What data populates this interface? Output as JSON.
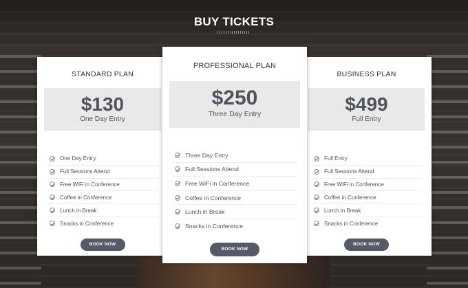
{
  "header": {
    "title": "BUY TICKETS"
  },
  "plans": [
    {
      "name": "STANDARD PLAN",
      "price": "$130",
      "entry": "One Day Entry",
      "features": [
        "One Day Entry",
        "Full Sessions Attend",
        "Free WiFi in Conference",
        "Coffee in Conference",
        "Lunch in Break",
        "Snacks in Conference"
      ],
      "button": "BOOK NOW"
    },
    {
      "name": "PROFESSIONAL PLAN",
      "price": "$250",
      "entry": "Three Day Entry",
      "features": [
        "Three Day Entry",
        "Full Sessions Attend",
        "Free WiFi in Conference",
        "Coffee in Conference",
        "Lunch in Break",
        "Snacks in Conference"
      ],
      "button": "BOOK NOW"
    },
    {
      "name": "BUSINESS PLAN",
      "price": "$499",
      "entry": "Full Entry",
      "features": [
        "Full Entry",
        "Full Sessions Attend",
        "Free WiFi in Conference",
        "Coffee in Conference",
        "Lunch in Break",
        "Snacks in Conference"
      ],
      "button": "BOOK NOW"
    }
  ],
  "icons": {
    "feature": "check-circle-icon"
  },
  "colors": {
    "button": "#555b66",
    "price": "#4f545c",
    "price_box": "#e9e9ea"
  }
}
